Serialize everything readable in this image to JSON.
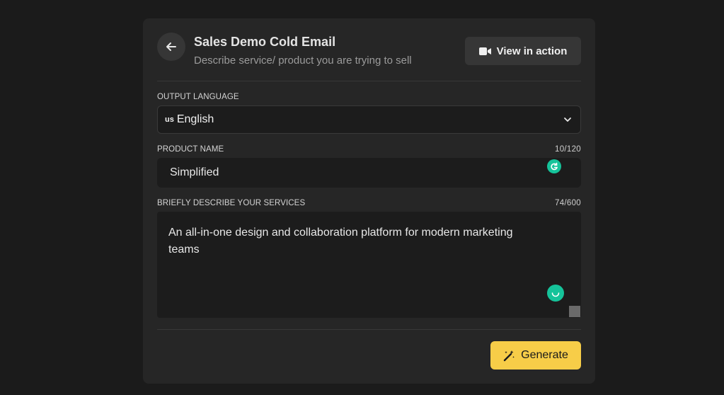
{
  "header": {
    "title": "Sales Demo Cold Email",
    "subtitle": "Describe service/ product you are trying to sell",
    "view_button_label": "View in action"
  },
  "output_language": {
    "label": "OUTPUT LANGUAGE",
    "flag_text": "us",
    "selected": "English"
  },
  "product_name": {
    "label": "PRODUCT NAME",
    "counter": "10/120",
    "value": "Simplified"
  },
  "services": {
    "label": "BRIEFLY DESCRIBE YOUR SERVICES",
    "counter": "74/600",
    "value": "An all-in-one design and collaboration platform for modern marketing teams"
  },
  "footer": {
    "generate_label": "Generate"
  },
  "colors": {
    "accent": "#f7cd48",
    "grammarly_green": "#15c39a",
    "card_bg": "#262626",
    "page_bg": "#1b1b1b"
  },
  "icons": [
    "arrow-left-icon",
    "video-camera-icon",
    "chevron-down-icon",
    "grammarly-icon",
    "magic-wand-icon"
  ]
}
